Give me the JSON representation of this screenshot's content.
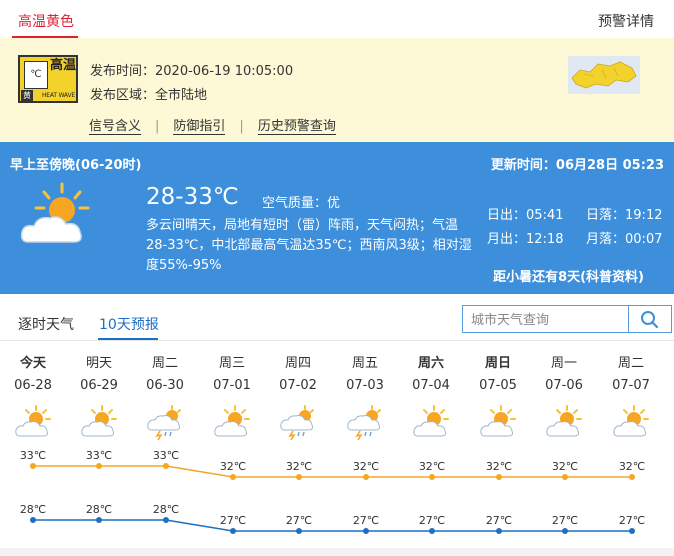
{
  "header": {
    "title": "高温黄色",
    "link": "预警详情"
  },
  "warning": {
    "icon": {
      "label_cn": "高温",
      "level_cn": "黄",
      "label_en": "HEAT WAVE",
      "symbol": "℃"
    },
    "time_label": "发布时间：",
    "time_value": "2020-06-19 10:05:00",
    "area_label": "发布区域：",
    "area_value": "全市陆地",
    "links": [
      "信号含义",
      "防御指引",
      "历史预警查询"
    ],
    "map_icon": "region-map-icon"
  },
  "today": {
    "period": "早上至傍晚(06-20时)",
    "update_label": "更新时间：",
    "update_value": "06月28日 05:23",
    "temp": "28-33℃",
    "air_label": "空气质量：",
    "air_value": "优",
    "description": "多云间晴天，局地有短时（雷）阵雨，天气闷热；气温28-33℃，中北部最高气温达35℃；西南风3级；相对湿度55%-95%",
    "sunrise_label": "日出：",
    "sunrise": "05:41",
    "sunset_label": "日落：",
    "sunset": "19:12",
    "moonrise_label": "月出：",
    "moonrise": "12:18",
    "moonset_label": "月落：",
    "moonset": "00:07",
    "note": "距小暑还有8天(科普资料)",
    "icon": "partly-cloudy-sun-icon",
    "color": "#3d8fdc"
  },
  "tabs": [
    "逐时天气",
    "10天预报"
  ],
  "active_tab": "10天预报",
  "search": {
    "placeholder": "城市天气查询",
    "icon": "search-icon"
  },
  "forecast": [
    {
      "weekday": "今天",
      "date": "06-28",
      "icon": "partly-cloudy-icon",
      "bold": true
    },
    {
      "weekday": "明天",
      "date": "06-29",
      "icon": "partly-cloudy-icon",
      "bold": false
    },
    {
      "weekday": "周二",
      "date": "06-30",
      "icon": "thunder-shower-icon",
      "bold": false
    },
    {
      "weekday": "周三",
      "date": "07-01",
      "icon": "partly-cloudy-icon",
      "bold": false
    },
    {
      "weekday": "周四",
      "date": "07-02",
      "icon": "thunder-shower-icon",
      "bold": false
    },
    {
      "weekday": "周五",
      "date": "07-03",
      "icon": "thunder-shower-icon",
      "bold": false
    },
    {
      "weekday": "周六",
      "date": "07-04",
      "icon": "partly-cloudy-icon",
      "bold": true
    },
    {
      "weekday": "周日",
      "date": "07-05",
      "icon": "partly-cloudy-icon",
      "bold": true
    },
    {
      "weekday": "周一",
      "date": "07-06",
      "icon": "partly-cloudy-icon",
      "bold": false
    },
    {
      "weekday": "周二",
      "date": "07-07",
      "icon": "partly-cloudy-icon",
      "bold": false
    }
  ],
  "chart_data": {
    "type": "line",
    "categories": [
      "06-28",
      "06-29",
      "06-30",
      "07-01",
      "07-02",
      "07-03",
      "07-04",
      "07-05",
      "07-06",
      "07-07"
    ],
    "series": [
      {
        "values": [
          33,
          33,
          33,
          32,
          32,
          32,
          32,
          32,
          32,
          32
        ],
        "color": "#f5a623"
      },
      {
        "values": [
          28,
          28,
          28,
          27,
          27,
          27,
          27,
          27,
          27,
          27
        ],
        "color": "#1d6fc3"
      }
    ],
    "unit": "℃"
  }
}
